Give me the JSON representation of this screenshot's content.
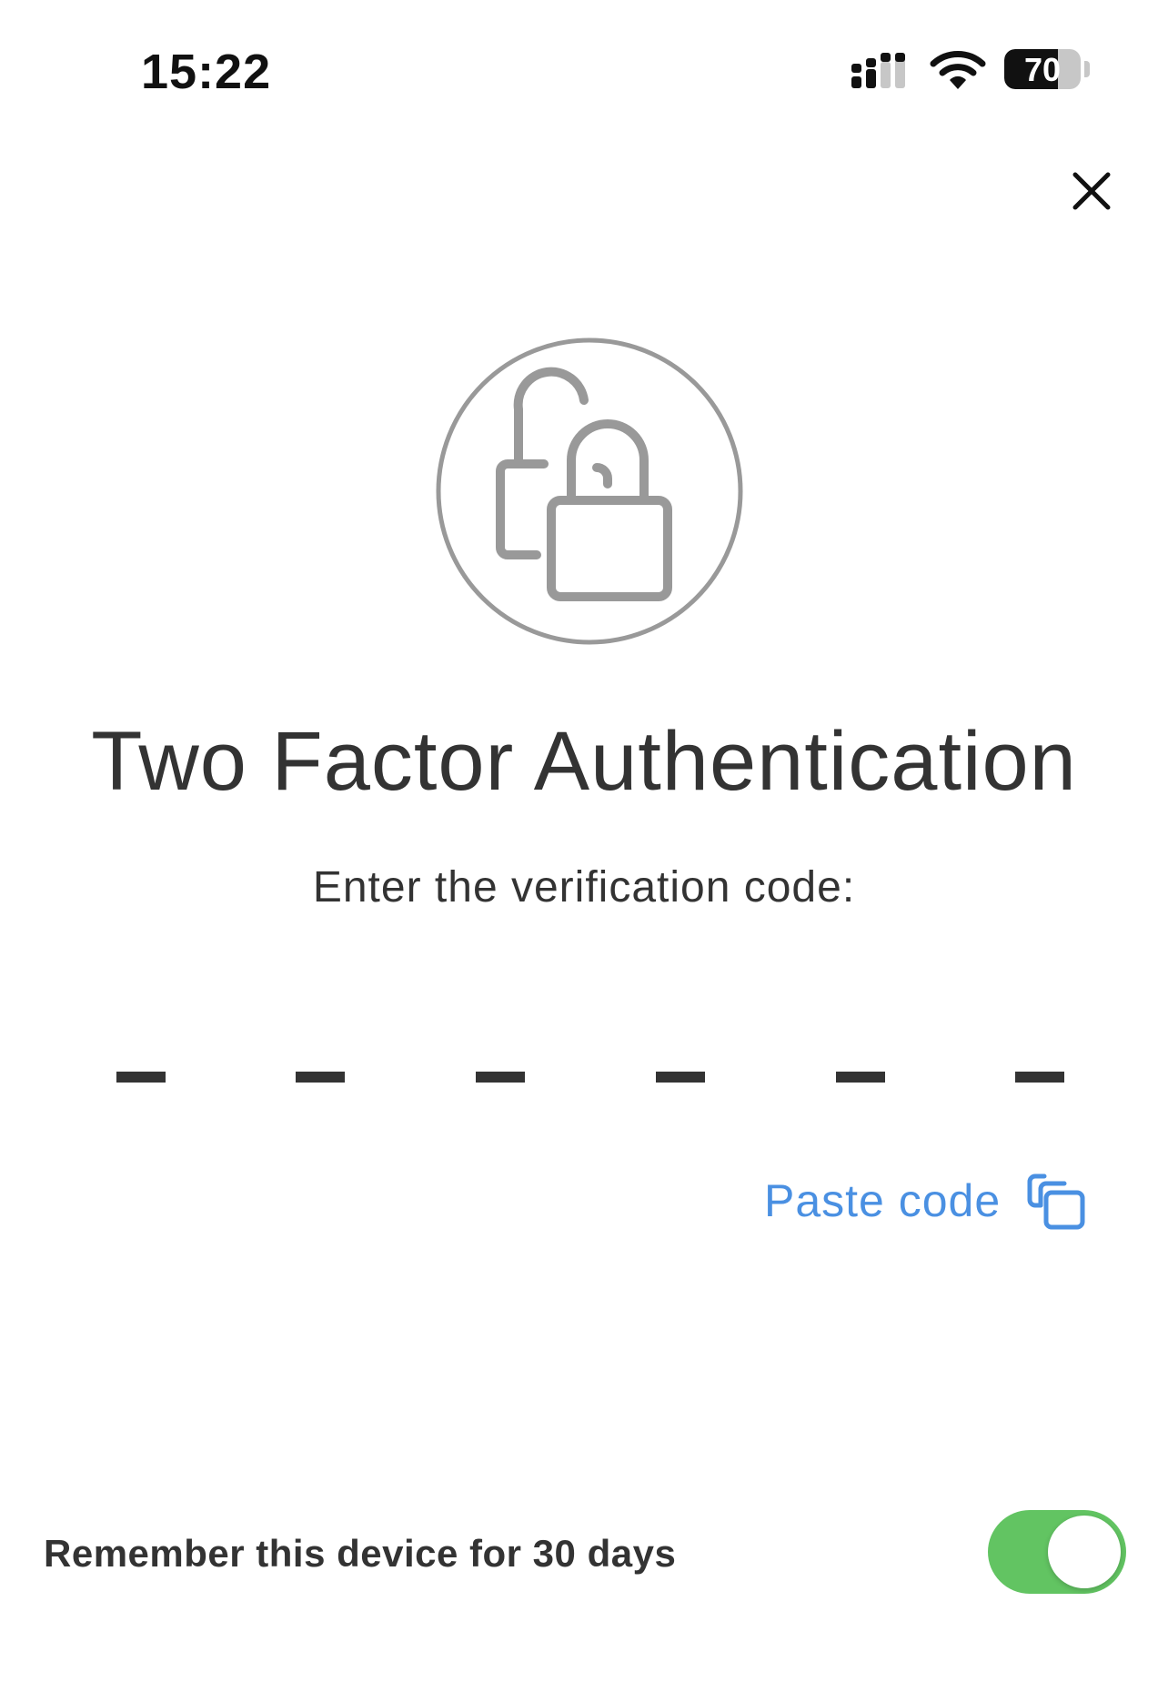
{
  "status_bar": {
    "time": "15:22",
    "battery_level": "70",
    "battery_fraction": 0.7,
    "icons": [
      "signal-icon",
      "wifi-icon",
      "battery-icon"
    ]
  },
  "header": {
    "close_icon": "close-icon"
  },
  "emblem": {
    "icon": "lock-icon"
  },
  "main": {
    "title": "Two Factor Authentication",
    "instruction": "Enter the verification code:",
    "code_length": 6,
    "code_digits": [
      "",
      "",
      "",
      "",
      "",
      ""
    ],
    "paste_label": "Paste code",
    "paste_icon": "copy-icon"
  },
  "footer": {
    "remember_label": "Remember this device for 30 days",
    "remember_enabled": true
  },
  "colors": {
    "accent": "#4a90e2",
    "toggle_on": "#62c462",
    "text": "#333333",
    "icon_gray": "#999999"
  }
}
